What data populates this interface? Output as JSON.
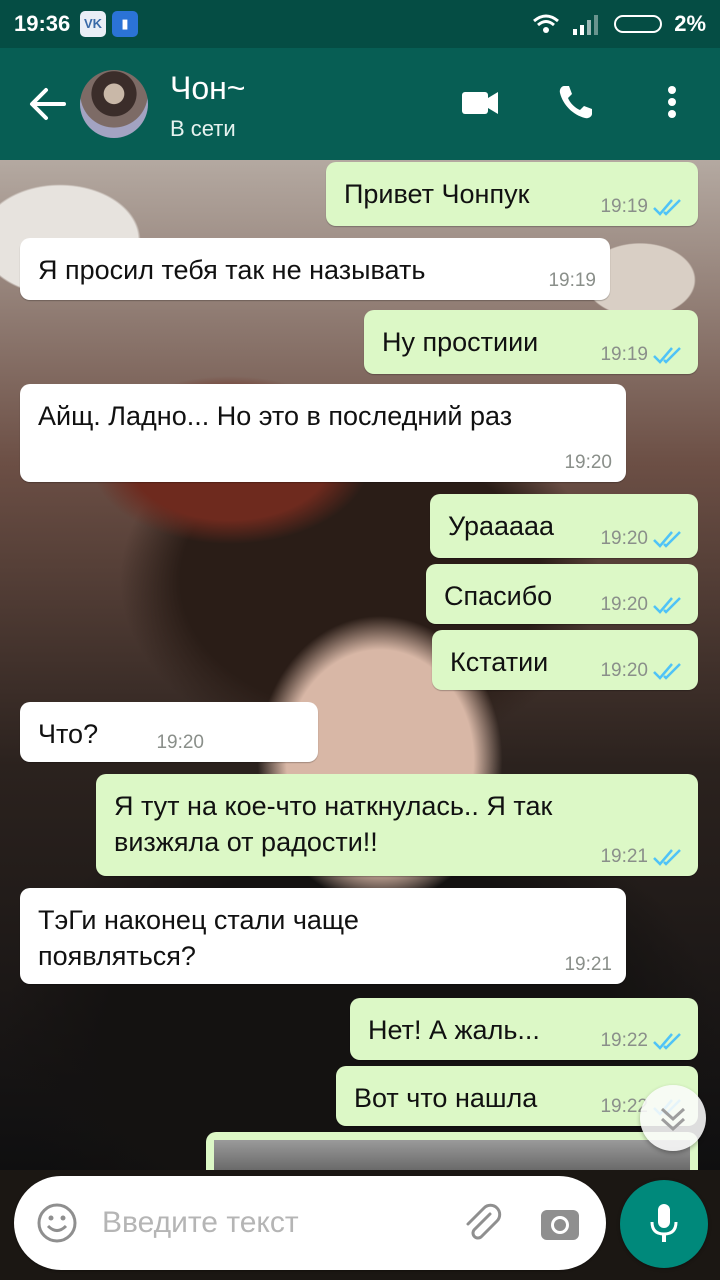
{
  "status_bar": {
    "time": "19:36",
    "app1": "VK",
    "battery_text": "2%"
  },
  "header": {
    "title": "Чон~",
    "subtitle": "В сети"
  },
  "messages": [
    {
      "text": "Привет Чонпук",
      "time": "19:19",
      "out": true
    },
    {
      "text": "Я просил тебя так не называть",
      "time": "19:19",
      "out": false
    },
    {
      "text": "Ну простиии",
      "time": "19:19",
      "out": true
    },
    {
      "text": "Айщ. Ладно... Но это в последний раз",
      "time": "19:20",
      "out": false
    },
    {
      "text": "Урааааа",
      "time": "19:20",
      "out": true
    },
    {
      "text": "Спасибо",
      "time": "19:20",
      "out": true
    },
    {
      "text": "Кстатии",
      "time": "19:20",
      "out": true
    },
    {
      "text": "Что?",
      "time": "19:20",
      "out": false
    },
    {
      "text": "Я тут на кое-что наткнулась.. Я так визжяла от радости!!",
      "time": "19:21",
      "out": true
    },
    {
      "text": "ТэГи наконец стали чаще появляться?",
      "time": "19:21",
      "out": false
    },
    {
      "text": "Нет! А жаль...",
      "time": "19:22",
      "out": true
    },
    {
      "text": "Вот что нашла",
      "time": "19:22",
      "out": true
    }
  ],
  "input": {
    "placeholder": "Введите текст"
  },
  "colors": {
    "header": "#075e54",
    "status_bar": "#054d44",
    "outgoing": "#dcf8c6",
    "incoming": "#ffffff",
    "read_ticks": "#4fc3f7",
    "mic_button": "#00897b"
  },
  "icons": [
    "back-arrow-icon",
    "video-call-icon",
    "phone-icon",
    "more-vert-icon",
    "emoji-icon",
    "attach-icon",
    "camera-icon",
    "mic-icon",
    "double-check-icon",
    "chevron-down-icon",
    "wifi-icon",
    "signal-icon",
    "battery-icon"
  ]
}
